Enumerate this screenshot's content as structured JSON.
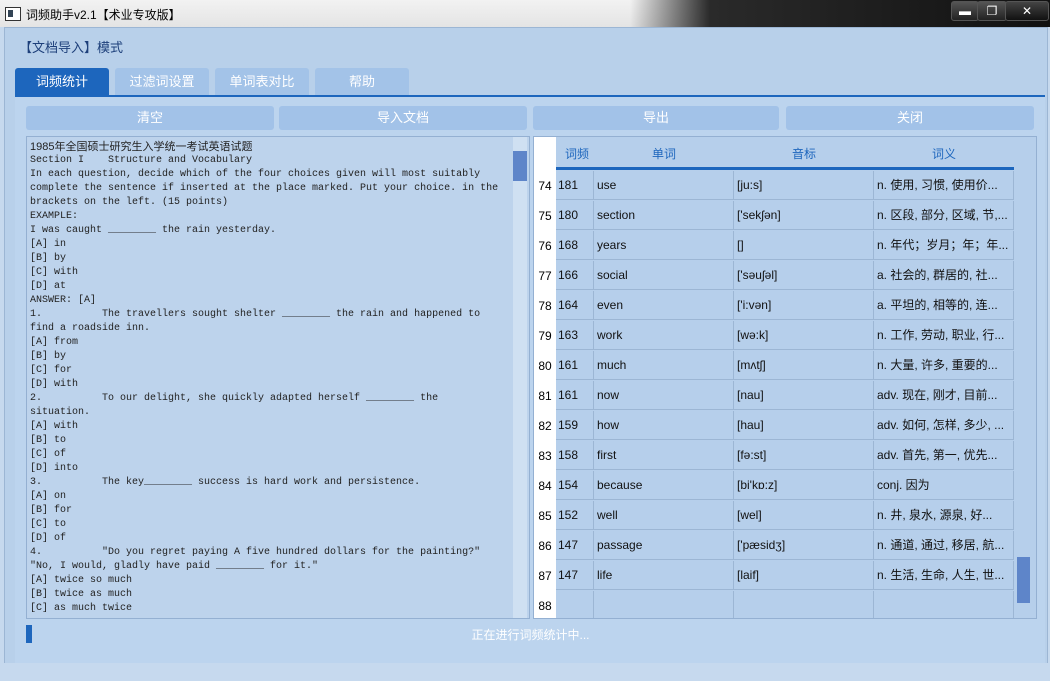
{
  "window": {
    "title": "词频助手v2.1【术业专攻版】",
    "min_label": "▬",
    "max_label": "❐",
    "close_label": "✕"
  },
  "mode_label": "【文档导入】模式",
  "tabs": [
    {
      "label": "词频统计",
      "active": true
    },
    {
      "label": "过滤词设置",
      "active": false
    },
    {
      "label": "单词表对比",
      "active": false
    },
    {
      "label": "帮助",
      "active": false
    }
  ],
  "toolbar": {
    "clear": "清空",
    "import": "导入文档",
    "export": "导出",
    "close": "关闭"
  },
  "document_text": {
    "first_line": "1985年全国硕士研究生入学统一考试英语试题",
    "body": "Section I    Structure and Vocabulary\nIn each question, decide which of the four choices given will most suitably\ncomplete the sentence if inserted at the place marked. Put your choice. in the\nbrackets on the left. (15 points)\nEXAMPLE:\nI was caught ________ the rain yesterday.\n[A] in\n[B] by\n[C] with\n[D] at\nANSWER: [A]\n1.          The travellers sought shelter ________ the rain and happened to\nfind a roadside inn.\n[A] from\n[B] by\n[C] for\n[D] with\n2.          To our delight, she quickly adapted herself ________ the\nsituation.\n[A] with\n[B] to\n[C] of\n[D] into\n3.          The key________ success is hard work and persistence.\n[A] on\n[B] for\n[C] to\n[D] of\n4.          \"Do you regret paying A five hundred dollars for the painting?\"\n\"No, I would, gladly have paid ________ for it.\"\n[A] twice so much\n[B] twice as much\n[C] as much twice"
  },
  "grid": {
    "headers": {
      "freq": "词频",
      "word": "单词",
      "phonetic": "音标",
      "meaning": "词义"
    },
    "rows": [
      {
        "n": "74",
        "freq": "181",
        "word": "use",
        "phonetic": "[ju:s]",
        "meaning": "n. 使用, 习惯, 使用价..."
      },
      {
        "n": "75",
        "freq": "180",
        "word": "section",
        "phonetic": "['sekʃən]",
        "meaning": "n. 区段, 部分, 区域, 节,..."
      },
      {
        "n": "76",
        "freq": "168",
        "word": "years",
        "phonetic": "[]",
        "meaning": "n. 年代；岁月；年；年..."
      },
      {
        "n": "77",
        "freq": "166",
        "word": "social",
        "phonetic": "['səuʃəl]",
        "meaning": "a. 社会的, 群居的, 社..."
      },
      {
        "n": "78",
        "freq": "164",
        "word": "even",
        "phonetic": "['i:vən]",
        "meaning": "a. 平坦的, 相等的, 连..."
      },
      {
        "n": "79",
        "freq": "163",
        "word": "work",
        "phonetic": "[wə:k]",
        "meaning": "n. 工作, 劳动, 职业, 行..."
      },
      {
        "n": "80",
        "freq": "161",
        "word": "much",
        "phonetic": "[mʌtʃ]",
        "meaning": "n. 大量, 许多, 重要的..."
      },
      {
        "n": "81",
        "freq": "161",
        "word": "now",
        "phonetic": "[nau]",
        "meaning": "adv. 现在, 刚才, 目前..."
      },
      {
        "n": "82",
        "freq": "159",
        "word": "how",
        "phonetic": "[hau]",
        "meaning": "adv. 如何, 怎样, 多少, ..."
      },
      {
        "n": "83",
        "freq": "158",
        "word": "first",
        "phonetic": "[fə:st]",
        "meaning": "adv. 首先, 第一, 优先..."
      },
      {
        "n": "84",
        "freq": "154",
        "word": "because",
        "phonetic": "[bi'kɒ:z]",
        "meaning": "conj. 因为"
      },
      {
        "n": "85",
        "freq": "152",
        "word": "well",
        "phonetic": "[wel]",
        "meaning": "n. 井, 泉水, 源泉, 好..."
      },
      {
        "n": "86",
        "freq": "147",
        "word": "passage",
        "phonetic": "['pæsidʒ]",
        "meaning": "n. 通道, 通过, 移居, 航..."
      },
      {
        "n": "87",
        "freq": "147",
        "word": "life",
        "phonetic": "[laif]",
        "meaning": "n. 生活, 生命, 人生, 世..."
      },
      {
        "n": "88",
        "freq": "",
        "word": "",
        "phonetic": "",
        "meaning": ""
      }
    ]
  },
  "status": {
    "text": "正在进行词频统计中...",
    "progress_fraction": 0.006
  },
  "colors": {
    "accent": "#1d66bd",
    "panel": "#b8d0ea",
    "button": "#a2c2e8"
  }
}
